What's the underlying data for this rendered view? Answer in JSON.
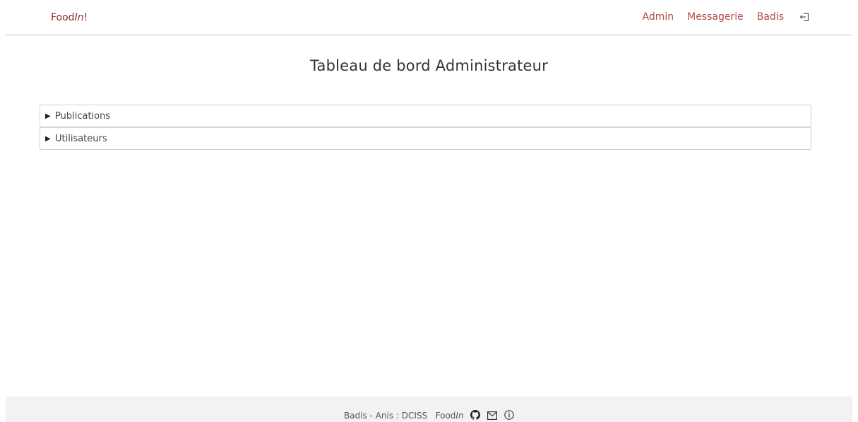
{
  "navbar": {
    "brand_text": "Food",
    "brand_italic": "In",
    "brand_suffix": "!",
    "links": [
      "Admin",
      "Messagerie",
      "Badis"
    ],
    "logout_icon": "logout-icon"
  },
  "page": {
    "title": "Tableau de bord Administrateur"
  },
  "accordion": {
    "items": [
      {
        "label": "Publications",
        "icon": "triangle-right-icon"
      },
      {
        "label": "Utilisateurs",
        "icon": "triangle-right-icon"
      }
    ]
  },
  "footer": {
    "authors": "Badis - Anis : DCISS",
    "brand_text": "Food",
    "brand_italic": "In",
    "icons": [
      "github-icon",
      "mail-icon",
      "info-icon"
    ]
  },
  "colors": {
    "brand": "#8e2a2a",
    "nav_link": "#b34a4a",
    "divider": "#e0b4b4",
    "footer_bg": "#f2f2f2"
  }
}
